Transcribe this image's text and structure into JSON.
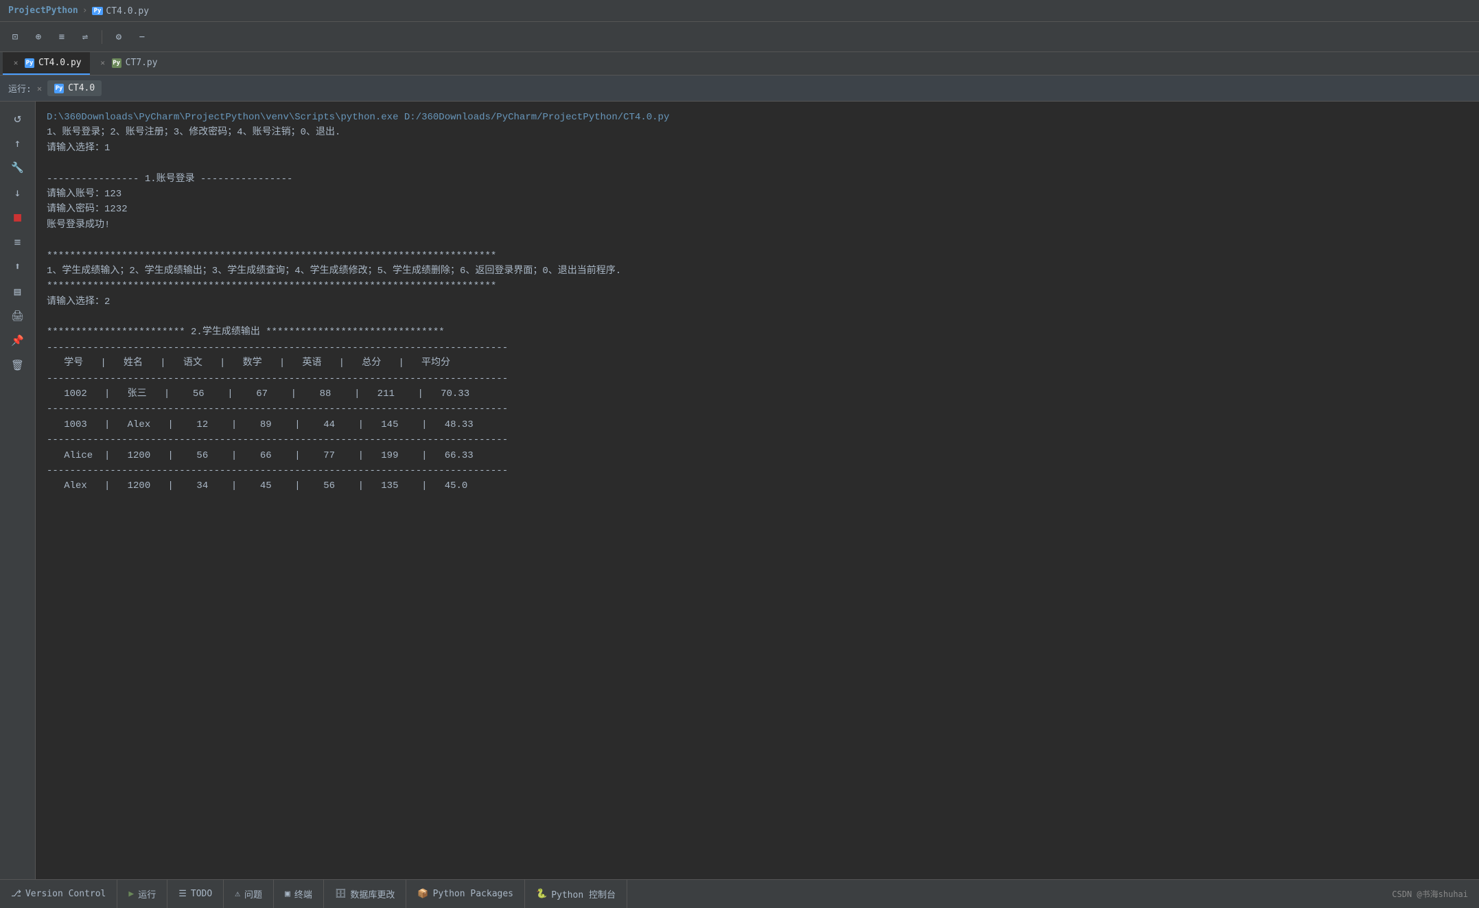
{
  "titleBar": {
    "projectName": "ProjectPython",
    "separator": "›",
    "fileName": "CT4.0.py"
  },
  "toolbar": {
    "buttons": [
      {
        "name": "terminal-icon",
        "icon": "⊡",
        "label": "Terminal"
      },
      {
        "name": "add-config-icon",
        "icon": "⊕",
        "label": "Add"
      },
      {
        "name": "list-icon",
        "icon": "≡",
        "label": "List"
      },
      {
        "name": "list-alt-icon",
        "icon": "⇌",
        "label": "List Alt"
      },
      {
        "name": "settings-icon",
        "icon": "⚙",
        "label": "Settings"
      },
      {
        "name": "minus-icon",
        "icon": "−",
        "label": "Minus"
      }
    ]
  },
  "tabs": [
    {
      "id": "ct4",
      "name": "CT4.0.py",
      "active": true,
      "hasClose": true
    },
    {
      "id": "ct7",
      "name": "CT7.py",
      "active": false,
      "hasClose": true
    }
  ],
  "runBar": {
    "label": "运行:",
    "activeTab": "CT4.0"
  },
  "sideToolbar": {
    "buttons": [
      {
        "name": "rerun-btn",
        "icon": "↺",
        "title": "Rerun"
      },
      {
        "name": "scroll-up-btn",
        "icon": "↑",
        "title": "Scroll Up"
      },
      {
        "name": "wrench-btn",
        "icon": "🔧",
        "title": "Settings"
      },
      {
        "name": "scroll-down-btn",
        "icon": "↓",
        "title": "Scroll Down"
      },
      {
        "name": "stop-btn",
        "icon": "■",
        "title": "Stop",
        "class": "red"
      },
      {
        "name": "list-btn",
        "icon": "≡",
        "title": "List"
      },
      {
        "name": "export-btn",
        "icon": "⬆",
        "title": "Export"
      },
      {
        "name": "format-btn",
        "icon": "▤",
        "title": "Format"
      },
      {
        "name": "print-btn",
        "icon": "🖨",
        "title": "Print"
      },
      {
        "name": "pin-btn",
        "icon": "📌",
        "title": "Pin"
      },
      {
        "name": "delete-btn",
        "icon": "🗑",
        "title": "Delete"
      }
    ]
  },
  "console": {
    "lines": [
      {
        "text": "D:\\360Downloads\\PyCharm\\ProjectPython\\venv\\Scripts\\python.exe D:/360Downloads/PyCharm/ProjectPython/CT4.0.py",
        "class": "path"
      },
      {
        "text": "1、账号登录；2、账号注册；3、修改密码；4、账号注销；0、退出.",
        "class": "output"
      },
      {
        "text": "请输入选择：1",
        "class": "output"
      },
      {
        "text": "",
        "class": "empty"
      },
      {
        "text": "---------------- 1.账号登录 ----------------",
        "class": "output"
      },
      {
        "text": "请输入账号：123",
        "class": "output"
      },
      {
        "text": "请输入密码：1232",
        "class": "output"
      },
      {
        "text": "账号登录成功!",
        "class": "output"
      },
      {
        "text": "",
        "class": "empty"
      },
      {
        "text": "******************************************************************************",
        "class": "output"
      },
      {
        "text": "1、学生成绩输入；2、学生成绩输出；3、学生成绩查询；4、学生成绩修改；5、学生成绩删除；6、返回登录界面；0、退出当前程序.",
        "class": "output"
      },
      {
        "text": "******************************************************************************",
        "class": "output"
      },
      {
        "text": "请输入选择：2",
        "class": "output"
      },
      {
        "text": "",
        "class": "empty"
      },
      {
        "text": "************************ 2.学生成绩输出 *******************************",
        "class": "output"
      },
      {
        "text": "--------------------------------------------------------------------------------",
        "class": "output"
      },
      {
        "text": "   学号   |   姓名   |   语文   |   数学   |   英语   |   总分   |   平均分",
        "class": "output"
      },
      {
        "text": "--------------------------------------------------------------------------------",
        "class": "output"
      },
      {
        "text": "   1002   |   张三   |    56    |    67    |    88    |   211    |   70.33",
        "class": "output"
      },
      {
        "text": "--------------------------------------------------------------------------------",
        "class": "output"
      },
      {
        "text": "   1003   |   Alex   |    12    |    89    |    44    |   145    |   48.33",
        "class": "output"
      },
      {
        "text": "--------------------------------------------------------------------------------",
        "class": "output"
      },
      {
        "text": "   Alice  |   1200   |    56    |    66    |    77    |   199    |   66.33",
        "class": "output"
      },
      {
        "text": "--------------------------------------------------------------------------------",
        "class": "output"
      },
      {
        "text": "   Alex   |   1200   |    34    |    45    |    56    |   135    |   45.0",
        "class": "output"
      }
    ]
  },
  "statusBar": {
    "items": [
      {
        "name": "version-control",
        "icon": "⎇",
        "label": "Version Control"
      },
      {
        "name": "run-status",
        "icon": "▶",
        "label": "运行",
        "iconColor": "green"
      },
      {
        "name": "todo",
        "icon": "☰",
        "label": "TODO"
      },
      {
        "name": "problems",
        "icon": "⚠",
        "label": "问题"
      },
      {
        "name": "terminal",
        "icon": "▣",
        "label": "终端"
      },
      {
        "name": "database",
        "icon": "🗄",
        "label": "数据库更改"
      },
      {
        "name": "python-packages",
        "icon": "📦",
        "label": "Python Packages"
      },
      {
        "name": "python-console",
        "icon": "🐍",
        "label": "Python 控制台"
      }
    ],
    "rightText": "CSDN @书海shuhai"
  }
}
